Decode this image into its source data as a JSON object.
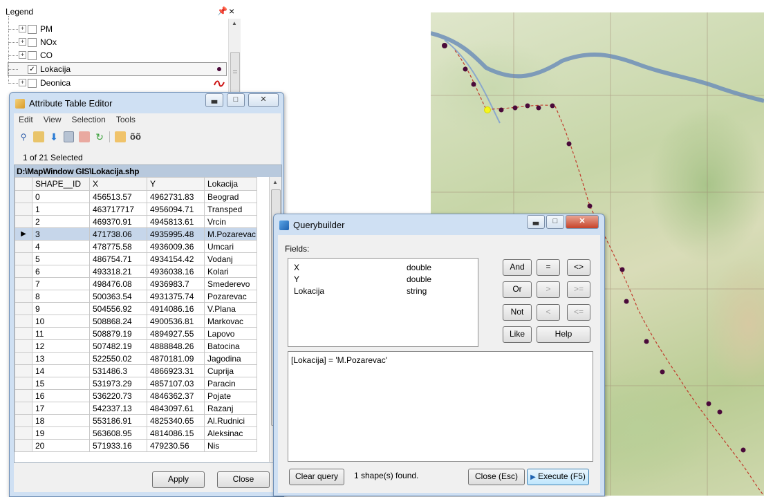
{
  "legend": {
    "title": "Legend",
    "pin": "p",
    "close": "×",
    "layers": [
      {
        "label": "PM",
        "checked": false,
        "symbol": ""
      },
      {
        "label": "NOx",
        "checked": false,
        "symbol": ""
      },
      {
        "label": "CO",
        "checked": false,
        "symbol": ""
      },
      {
        "label": "Lokacija",
        "checked": true,
        "symbol": "point"
      },
      {
        "label": "Deonica",
        "checked": false,
        "symbol": "line"
      }
    ]
  },
  "attribute_table": {
    "title": "Attribute Table Editor",
    "menu": [
      "Edit",
      "View",
      "Selection",
      "Tools"
    ],
    "toolbar_icons": [
      "zoom-icon",
      "open-icon",
      "import-icon",
      "calculator-icon",
      "edit-icon",
      "refresh-icon",
      "pencil-icon",
      "binoculars-icon"
    ],
    "selection_status": "1 of 21 Selected",
    "file_path": "D:\\MapWindow GIS\\Lokacija.shp",
    "columns": [
      "SHAPE__ID",
      "X",
      "Y",
      "Lokacija"
    ],
    "selected_index": 3,
    "rows": [
      [
        "0",
        "456513.57",
        "4962731.83",
        "Beograd"
      ],
      [
        "1",
        "463717717",
        "4956094.71",
        "Transped"
      ],
      [
        "2",
        "469370.91",
        "4945813.61",
        "Vrcin"
      ],
      [
        "3",
        "471738.06",
        "4935995.48",
        "M.Pozarevac"
      ],
      [
        "4",
        "478775.58",
        "4936009.36",
        "Umcari"
      ],
      [
        "5",
        "486754.71",
        "4934154.42",
        "Vodanj"
      ],
      [
        "6",
        "493318.21",
        "4936038.16",
        "Kolari"
      ],
      [
        "7",
        "498476.08",
        "4936983.7",
        "Smederevo"
      ],
      [
        "8",
        "500363.54",
        "4931375.74",
        "Pozarevac"
      ],
      [
        "9",
        "504556.92",
        "4914086.16",
        "V.Plana"
      ],
      [
        "10",
        "508868.24",
        "4900536.81",
        "Markovac"
      ],
      [
        "11",
        "508879.19",
        "4894927.55",
        "Lapovo"
      ],
      [
        "12",
        "507482.19",
        "4888848.26",
        "Batocina"
      ],
      [
        "13",
        "522550.02",
        "4870181.09",
        "Jagodina"
      ],
      [
        "14",
        "531486.3",
        "4866923.31",
        "Cuprija"
      ],
      [
        "15",
        "531973.29",
        "4857107.03",
        "Paracin"
      ],
      [
        "16",
        "536220.73",
        "4846362.37",
        "Pojate"
      ],
      [
        "17",
        "542337.13",
        "4843097.61",
        "Razanj"
      ],
      [
        "18",
        "553186.91",
        "4825340.65",
        "Al.Rudnici"
      ],
      [
        "19",
        "563608.95",
        "4814086.15",
        "Aleksinac"
      ],
      [
        "20",
        "571933.16",
        "479230.56",
        "Nis"
      ]
    ],
    "apply_label": "Apply",
    "close_label": "Close"
  },
  "querybuilder": {
    "title": "Querybuilder",
    "fields_label": "Fields:",
    "fields": [
      {
        "name": "X",
        "type": "double"
      },
      {
        "name": "Y",
        "type": "double"
      },
      {
        "name": "Lokacija",
        "type": "string"
      }
    ],
    "operators": {
      "and": "And",
      "eq": "=",
      "ne": "<>",
      "or": "Or",
      "gt": ">",
      "ge": ">=",
      "not": "Not",
      "lt": "<",
      "le": "<=",
      "like": "Like",
      "help": "Help"
    },
    "query_text": "[Lokacija]  = 'M.Pozarevac'",
    "clear_label": "Clear query",
    "result_text": "1 shape(s) found.",
    "close_label": "Close (Esc)",
    "execute_label": "Execute (F5)"
  },
  "colors": {
    "point_symbol": "#4a0a3a",
    "line_symbol": "#cc1111",
    "selected_point": "#f5f51e",
    "river": "#6f8fb8"
  }
}
